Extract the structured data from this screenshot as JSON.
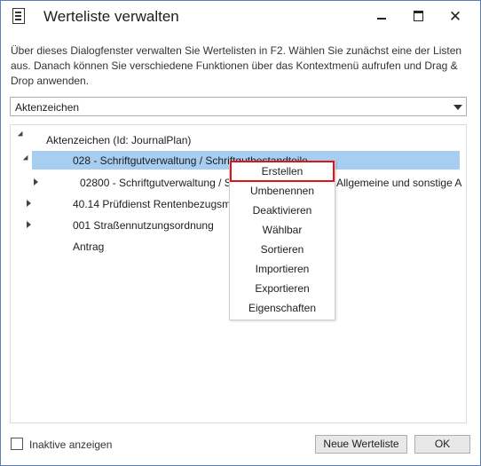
{
  "window": {
    "title": "Werteliste verwalten",
    "close_glyph": "✕"
  },
  "description": "Über dieses Dialogfenster verwalten Sie Wertelisten in F2. Wählen Sie zunächst eine der Listen aus. Danach können Sie verschiedene Funktionen über das Kontextmenü aufrufen und Drag & Drop anwenden.",
  "combo": {
    "value": "Aktenzeichen"
  },
  "tree": {
    "root": "Aktenzeichen (Id: JournalPlan)",
    "n1": "028 - Schriftgutverwaltung / Schriftgutbestandteile",
    "n1_1_left": "02800 - Schriftgutverwaltung / S",
    "n1_1_right": "Allgemeine und sonstige A",
    "n2": "40.14 Prüfdienst Rentenbezugsmi",
    "n3": "001 Straßennutzungsordnung",
    "n4": "Antrag"
  },
  "context_menu": {
    "items": [
      "Erstellen",
      "Umbenennen",
      "Deaktivieren",
      "Wählbar",
      "Sortieren",
      "Importieren",
      "Exportieren",
      "Eigenschaften"
    ]
  },
  "footer": {
    "checkbox_label": "Inaktive anzeigen",
    "new_button": "Neue Werteliste",
    "ok_button": "OK"
  },
  "colors": {
    "selection": "#a7cdf0",
    "highlight_border": "#e01414"
  }
}
